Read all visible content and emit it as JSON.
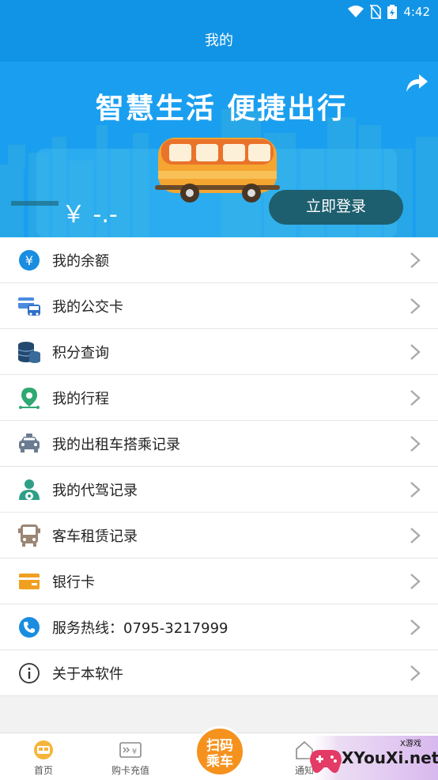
{
  "status_bar": {
    "time": "4:42"
  },
  "header": {
    "title": "我的"
  },
  "hero": {
    "slogan": "智慧生活  便捷出行",
    "balance": "￥ -.-",
    "login_label": "立即登录"
  },
  "menu": {
    "items": [
      {
        "label": "我的余额",
        "icon": "yuan-icon"
      },
      {
        "label": "我的公交卡",
        "icon": "bus-card-icon"
      },
      {
        "label": "积分查询",
        "icon": "coins-icon"
      },
      {
        "label": "我的行程",
        "icon": "location-pin-icon"
      },
      {
        "label": "我的出租车搭乘记录",
        "icon": "taxi-icon"
      },
      {
        "label": "我的代驾记录",
        "icon": "driver-icon"
      },
      {
        "label": "客车租赁记录",
        "icon": "coach-bus-icon"
      },
      {
        "label": "银行卡",
        "icon": "bank-card-icon"
      },
      {
        "label": "服务热线：0795-3217999",
        "icon": "phone-icon"
      },
      {
        "label": "关于本软件",
        "icon": "info-icon"
      }
    ]
  },
  "tab_bar": {
    "home": "首页",
    "recharge": "购卡充值",
    "scan": "扫码乘车",
    "scan_line1": "扫码",
    "scan_line2": "乘车",
    "notice": "通知"
  },
  "watermark": {
    "brand": "XYouXi.net",
    "tag": "X游戏"
  },
  "colors": {
    "primary": "#1294e6",
    "accent_orange": "#f5921e",
    "login_button": "#1d5f6f"
  }
}
